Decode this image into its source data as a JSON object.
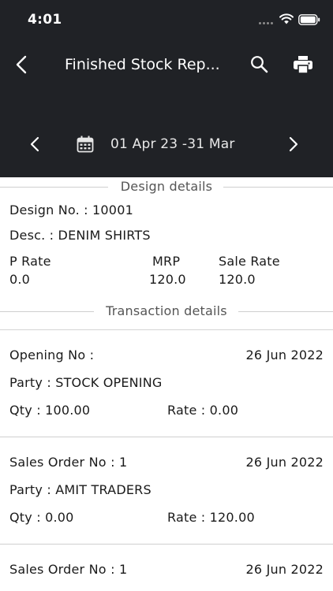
{
  "status_bar": {
    "time": "4:01"
  },
  "header": {
    "title": "Finished Stock Rep...",
    "date_range": "01 Apr 23 -31 Mar"
  },
  "design_section": {
    "title": "Design details",
    "design_no": "Design No. : 10001",
    "desc": "Desc. : DENIM SHIRTS",
    "p_rate_label": "P Rate",
    "p_rate_value": "0.0",
    "mrp_label": "MRP",
    "mrp_value": "120.0",
    "sale_rate_label": "Sale Rate",
    "sale_rate_value": "120.0"
  },
  "transaction_section": {
    "title": "Transaction details",
    "items": [
      {
        "label": "Opening No :",
        "date": "26 Jun 2022",
        "party": "Party : STOCK OPENING",
        "qty": "Qty : 100.00",
        "rate": "Rate : 0.00"
      },
      {
        "label": "Sales Order No : 1",
        "date": "26 Jun 2022",
        "party": "Party : AMIT TRADERS",
        "qty": "Qty : 0.00",
        "rate": "Rate : 120.00"
      },
      {
        "label": "Sales Order No : 1",
        "date": "26 Jun 2022"
      }
    ]
  },
  "icons": {
    "back": "chevron-left-icon",
    "search": "search-icon",
    "print": "printer-icon",
    "prev": "chevron-left-icon",
    "next": "chevron-right-icon",
    "calendar": "calendar-icon",
    "wifi": "wifi-icon",
    "battery": "battery-icon"
  },
  "colors": {
    "header_bg": "#202226",
    "text": "#1a1a1a",
    "divider": "#cfcfcf"
  }
}
